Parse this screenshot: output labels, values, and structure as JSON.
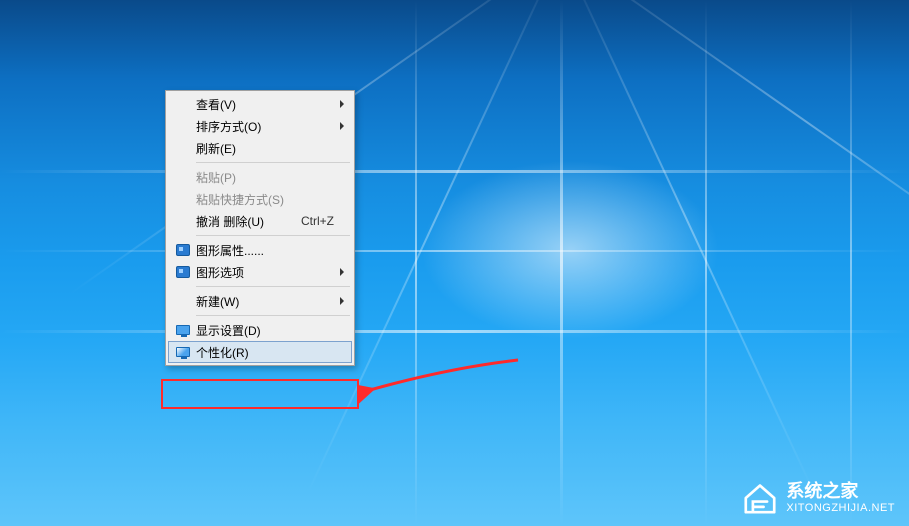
{
  "context_menu": {
    "items": {
      "view": {
        "label": "查看(V)"
      },
      "sort": {
        "label": "排序方式(O)"
      },
      "refresh": {
        "label": "刷新(E)"
      },
      "paste": {
        "label": "粘贴(P)"
      },
      "paste_shortcut": {
        "label": "粘贴快捷方式(S)"
      },
      "undo_delete": {
        "label": "撤消 删除(U)",
        "shortcut": "Ctrl+Z"
      },
      "gfx_props": {
        "label": "图形属性......"
      },
      "gfx_options": {
        "label": "图形选项"
      },
      "new": {
        "label": "新建(W)"
      },
      "display": {
        "label": "显示设置(D)"
      },
      "personalize": {
        "label": "个性化(R)"
      }
    }
  },
  "watermark": {
    "title": "系统之家",
    "url": "XITONGZHIJIA.NET"
  }
}
